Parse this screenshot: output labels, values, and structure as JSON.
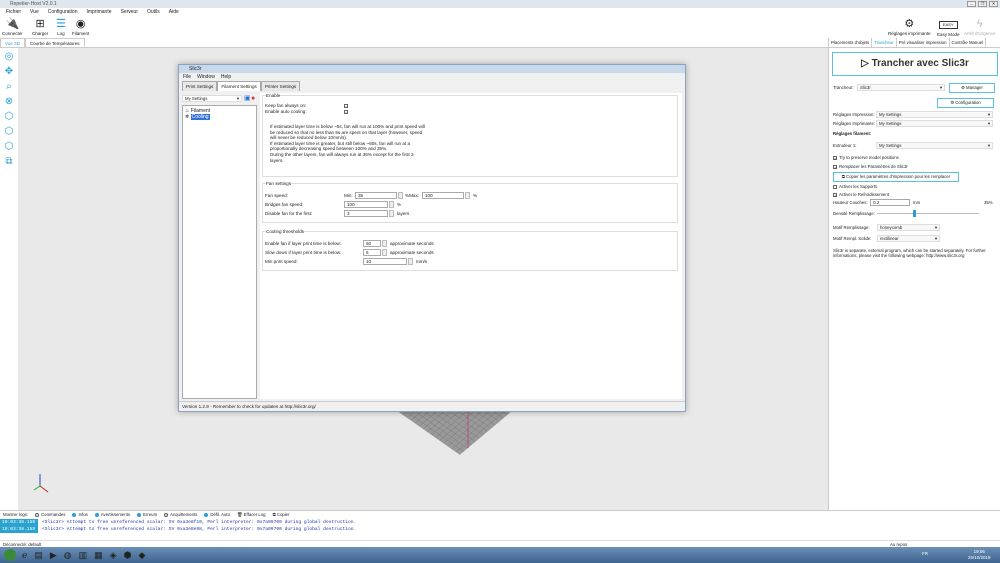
{
  "app": {
    "title": "Repetier-Host V2.0.1"
  },
  "menu": [
    "Fichier",
    "Vue",
    "Configuration",
    "Imprimante",
    "Serveur",
    "Outils",
    "Aide"
  ],
  "toolbar": {
    "connect": "Connecter",
    "load": "Charger",
    "log": "Log",
    "filament": "Filament",
    "printer_settings": "Réglages imprimante",
    "easy_mode": "Easy Mode",
    "emergency": "Arrêt d'Urgence",
    "easy_badge": "EASY"
  },
  "view_tabs": [
    "Vue 3D",
    "Courbe de Températures"
  ],
  "right_tabs": [
    "Placements d'objets",
    "Trancheur",
    "Pré visualiser impression",
    "Contrôle Manuel"
  ],
  "slicer": {
    "slice_button": "Trancher avec Slic3r",
    "slicer_label": "Trancheur:",
    "slicer_value": "Slic3r",
    "manager": "Manager",
    "configuration": "Configuration",
    "print_label": "Réglages Impression:",
    "print_value": "My Settings",
    "printer_label": "Réglages Imprimante:",
    "printer_value": "My Settings",
    "filament_heading": "Réglages filament:",
    "extruder_label": "Extrudeur 1:",
    "extruder_value": "My Settings",
    "preserve": "Try to preserve model positions",
    "override": "Remplacer les Paramètres de Slic3r",
    "copy_button": "Copier les paramètres d'impression pour les remplacer",
    "supports": "Activer les Supports",
    "cooling": "Activer le Refroidissement",
    "layer_label": "Hauteur Couches:",
    "layer_value": "0.2",
    "layer_unit": "mm",
    "infill_pct": "35%",
    "infill_label": "Densité Remplissage:",
    "infill_fraction": 0.35,
    "pattern_label": "Motif Remplissage:",
    "pattern_value": "honeycomb",
    "solid_label": "Motif Rempl. Solide:",
    "solid_value": "rectilinear",
    "note": "Slic3r is separate, external program, which can be started separately. For further informations, please visit the following webpage: http://www.slic3r.org"
  },
  "dialog": {
    "title": "Slic3r",
    "menu": [
      "File",
      "Window",
      "Help"
    ],
    "tabs": [
      "Print Settings",
      "Filament Settings",
      "Printer Settings"
    ],
    "preset": "My Settings",
    "tree": [
      "Filament",
      "Cooling"
    ],
    "enable_legend": "Enable",
    "keep_fan": "Keep fan always on:",
    "auto_cool": "Enable auto cooling:",
    "desc": [
      "If estimated layer time is below ~5s, fan will run at 100% and print speed will",
      "be reduced so that no less than 5s are spent on that layer (however, speed",
      "will never be reduced below 10mm/s).",
      "If estimated layer time is greater, but still below ~60s, fan will run at a",
      "proportionally decreasing speed between 100% and 35%.",
      "During the other layers, fan will always run at 35% except for the first 3",
      "layers."
    ],
    "fan_legend": "Fan settings",
    "fan_speed": "Fan speed:",
    "min_label": "Min:",
    "min_value": "35",
    "max_label": "%Max:",
    "max_value": "100",
    "pct": "%",
    "bridges": "Bridges fan speed:",
    "bridges_value": "100",
    "disable_first": "Disable fan for the first:",
    "disable_value": "3",
    "layers": "layers",
    "thr_legend": "Cooling thresholds",
    "enable_below": "Enable fan if layer print time is below:",
    "enable_below_value": "60",
    "approx": "approximate seconds",
    "slow_below": "Slow down if layer print time is below:",
    "slow_value": "5",
    "min_speed": "Min print speed:",
    "min_speed_value": "10",
    "mms": "mm/s",
    "version": "Version 1.2.9 - Remember to check for updates at http://slic3r.org/"
  },
  "logs": {
    "label": "Montrer logs:",
    "filters": [
      {
        "label": "Commandes",
        "on": false
      },
      {
        "label": "Infos",
        "on": true
      },
      {
        "label": "Avertissements",
        "on": true
      },
      {
        "label": "Erreurs",
        "on": true
      },
      {
        "label": "Acquittements",
        "on": false
      },
      {
        "label": "Défil. Auto",
        "on": true
      }
    ],
    "clear": "Effacer Log",
    "copy": "Copier",
    "lines": [
      {
        "time": "19:03:38.159",
        "msg": "<Slic3r> Attempt to free unreferenced scalar: SV 0xa3e8f10, Perl interpreter: 0x7a09700 during global destruction."
      },
      {
        "time": "19:03:38.159",
        "msg": "<Slic3r> Attempt to free unreferenced scalar: SV 0xa3e8e98, Perl interpreter: 0x7a09700 during global destruction."
      }
    ]
  },
  "status": {
    "left": "Déconnecté: default",
    "right": "Au repos"
  },
  "taskbar": {
    "lang": "FR",
    "time": "19:06",
    "date": "25/10/2018"
  }
}
